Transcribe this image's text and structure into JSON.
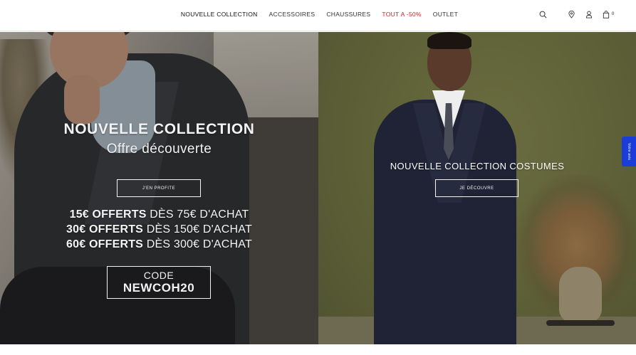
{
  "nav": {
    "items": [
      {
        "label": "NOUVELLE COLLECTION"
      },
      {
        "label": "ACCESSOIRES"
      },
      {
        "label": "CHAUSSURES"
      },
      {
        "label": "TOUT A -50%"
      },
      {
        "label": "OUTLET"
      }
    ],
    "sale_color": "#d42027"
  },
  "tools": {
    "icons": [
      "search-icon",
      "location-pin-icon",
      "user-icon",
      "bag-icon"
    ],
    "cart_count": "0"
  },
  "left_banner": {
    "title": "NOUVELLE COLLECTION",
    "subtitle": "Offre découverte",
    "button_label": "J'EN PROFITE",
    "offers": [
      {
        "amount": "15€ OFFERTS",
        "condition": " DÈS 75€ D'ACHAT"
      },
      {
        "amount": "30€ OFFERTS",
        "condition": " DÈS 150€ D'ACHAT"
      },
      {
        "amount": "60€ OFFERTS",
        "condition": " DÈS 300€ D'ACHAT"
      }
    ],
    "code_label": "CODE",
    "code_value": "NEWCOH20"
  },
  "right_banner": {
    "title": "NOUVELLE COLLECTION COSTUMES",
    "button_label": "JE DÉCOUVRE"
  },
  "side_tab": {
    "label": "Votre avis",
    "color": "#1a3cd8"
  }
}
